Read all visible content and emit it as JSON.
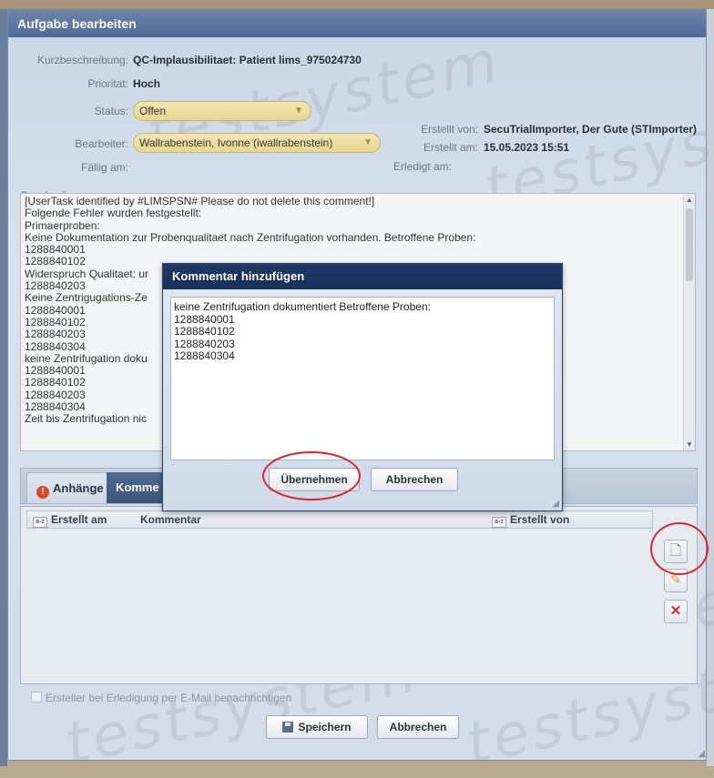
{
  "window": {
    "title": "Aufgabe bearbeiten"
  },
  "fields": {
    "kurzbeschreibung_label": "Kurzbeschreibung:",
    "kurzbeschreibung_value": "QC-Implausibilitaet: Patient lims_975024730",
    "prioritaet_label": "Prioritat:",
    "prioritaet_value": "Hoch",
    "status_label": "Status:",
    "status_value": "Offen",
    "bearbeiter_label": "Bearbeiter:",
    "bearbeiter_value": "Wallrabenstein, Ivonne (iwallrabenstein)",
    "faellig_label": "Fällig am:",
    "faellig_value": "",
    "erstellt_von_label": "Erstellt von:",
    "erstellt_von_value": "SecuTrialImporter, Der Gute (STImporter)",
    "erstellt_am_label": "Erstellt am:",
    "erstellt_am_value": "15.05.2023 15:51",
    "erledigt_am_label": "Erledigt am:",
    "erledigt_am_value": ""
  },
  "beschreibung": {
    "label": "Beschreibung:",
    "lines": [
      "[UserTask identified by #LIMSPSN# Please do not delete this comment!]",
      "Folgende Fehler wurden festgestellt:",
      "Primaerproben:",
      "Keine Dokumentation zur Probenqualitaet nach Zentrifugation vorhanden. Betroffene Proben:",
      "1288840001",
      "1288840102",
      "Widerspruch Qualitaet: ur",
      "1288840203",
      "Keine Zentrigugations-Ze",
      "1288840001",
      "1288840102",
      "1288840203",
      "1288840304",
      "keine Zentrifugation doku",
      "1288840001",
      "1288840102",
      "1288840203",
      "1288840304",
      "Zeit bis Zentrifugation nic"
    ]
  },
  "tabs": [
    {
      "label": "Anhänge"
    },
    {
      "label": "Komme"
    }
  ],
  "grid": {
    "columns": [
      "Erstellt am",
      "Kommentar",
      "Erstellt von"
    ],
    "sort_icon": "a-z"
  },
  "side_buttons": {
    "add_icon": "add-note-icon",
    "edit_icon": "edit-icon",
    "delete_icon": "delete-icon"
  },
  "notify_checkbox": {
    "label": "Ersteller bei Erledigung per E-Mail benachrichtigen",
    "checked": true
  },
  "footer": {
    "save_label": "Speichern",
    "cancel_label": "Abbrechen"
  },
  "modal": {
    "title": "Kommentar hinzufügen",
    "text": "keine Zentrifugation dokumentiert Betroffene Proben:\n1288840001\n1288840102\n1288840203\n1288840304",
    "ok_label": "Übernehmen",
    "cancel_label": "Abbrechen"
  },
  "watermark": "testsystem",
  "colors": {
    "highlight": "#e0222a",
    "title_bar": "#4e6a96",
    "modal_title": "#1f3a66"
  }
}
